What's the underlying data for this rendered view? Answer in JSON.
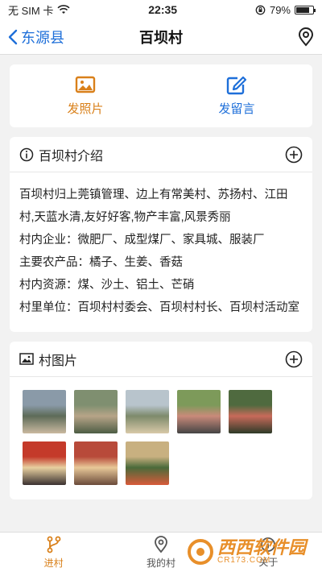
{
  "status_bar": {
    "carrier": "无 SIM 卡",
    "time": "22:35",
    "battery_pct_label": "79%",
    "battery_level": 0.79
  },
  "nav": {
    "back_label": "东源县",
    "title": "百坝村"
  },
  "actions": [
    {
      "label": "发照片",
      "icon": "image-icon",
      "color": "#d9801a"
    },
    {
      "label": "发留言",
      "icon": "edit-icon",
      "color": "#1e6fd9"
    }
  ],
  "intro": {
    "title": "百坝村介绍",
    "paragraphs": [
      "百坝村归上莞镇管理、边上有常美村、苏扬村、江田村,天蓝水清,友好好客,物产丰富,风景秀丽",
      "村内企业：微肥厂、成型煤厂、家具城、服装厂",
      "主要农产品：橘子、生姜、香菇",
      "村内资源：煤、沙土、铝土、芒硝",
      "村里单位：百坝村村委会、百坝村村长、百坝村活动室"
    ]
  },
  "photos": {
    "title": "村图片",
    "items": [
      {
        "name": "photo-1",
        "colors": [
          "#8a9aa8",
          "#5d6b58",
          "#c9b9a0"
        ]
      },
      {
        "name": "photo-2",
        "colors": [
          "#7f8f70",
          "#b7a488",
          "#4d5d44"
        ]
      },
      {
        "name": "photo-3",
        "colors": [
          "#b8c4cc",
          "#7d8a6b",
          "#d8c9a8"
        ]
      },
      {
        "name": "photo-4",
        "colors": [
          "#7d9a5a",
          "#c98a7a",
          "#444"
        ]
      },
      {
        "name": "photo-5",
        "colors": [
          "#4f6a3f",
          "#c86a5a",
          "#2d3a28"
        ]
      },
      {
        "name": "photo-6",
        "colors": [
          "#c43a2a",
          "#e8d0a0",
          "#3a3030"
        ]
      },
      {
        "name": "photo-7",
        "colors": [
          "#b84a3a",
          "#e8c898",
          "#6a4a3a"
        ]
      },
      {
        "name": "photo-8",
        "colors": [
          "#c8b080",
          "#4a6a3a",
          "#d85a3a"
        ]
      }
    ]
  },
  "tabs": [
    {
      "label": "进村",
      "icon": "branch-icon",
      "active": true
    },
    {
      "label": "我的村",
      "icon": "pin-icon",
      "active": false
    },
    {
      "label": "关于",
      "icon": "info-icon",
      "active": false
    }
  ],
  "watermark": {
    "brand": "西西软件园",
    "site": "CR173.COM"
  }
}
